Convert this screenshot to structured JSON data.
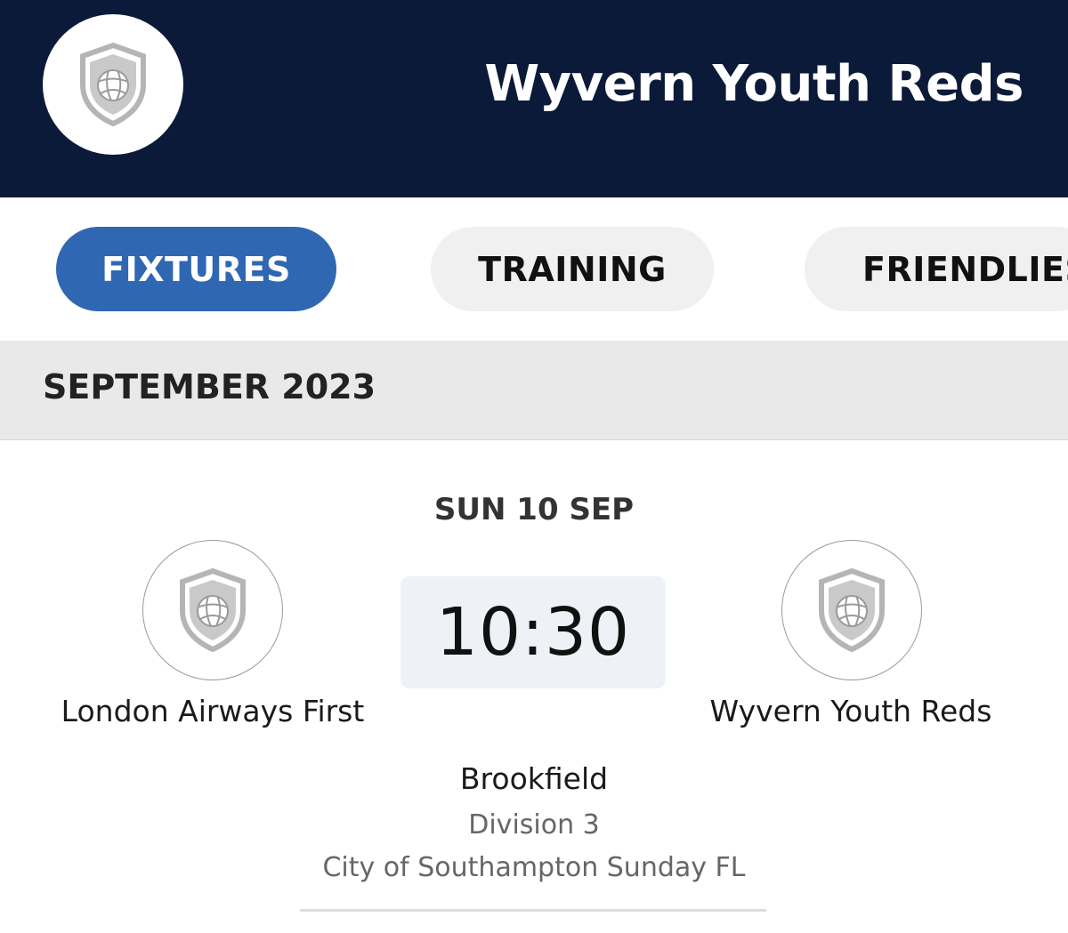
{
  "header": {
    "title": "Wyvern Youth Reds",
    "logo_icon": "shield-ball-icon"
  },
  "tabs": [
    {
      "label": "FIXTURES",
      "active": true
    },
    {
      "label": "TRAINING",
      "active": false
    },
    {
      "label": "FRIENDLIES",
      "active": false
    }
  ],
  "month": {
    "label": "SEPTEMBER 2023"
  },
  "match": {
    "date": "SUN 10 SEP",
    "time": "10:30",
    "home_team": "London Airways First",
    "away_team": "Wyvern Youth Reds",
    "venue": "Brookfield",
    "division": "Division 3",
    "league": "City of Southampton Sunday FL"
  },
  "colors": {
    "header_bg": "#0b1a38",
    "active_tab": "#2f67b2",
    "inactive_tab": "#f0f0f0",
    "month_bar": "#e9e9e9",
    "time_box": "#eef2f7"
  }
}
